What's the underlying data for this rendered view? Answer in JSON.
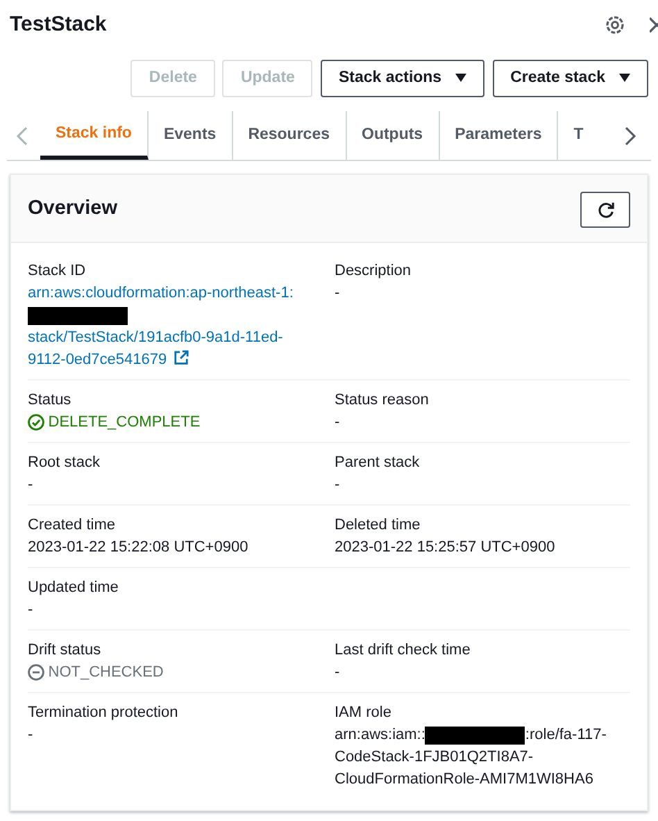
{
  "title": "TestStack",
  "buttons": [
    {
      "label": "Delete",
      "disabled": true,
      "dropdown": false
    },
    {
      "label": "Update",
      "disabled": true,
      "dropdown": false
    },
    {
      "label": "Stack actions",
      "disabled": false,
      "dropdown": true
    },
    {
      "label": "Create stack",
      "disabled": false,
      "dropdown": true
    }
  ],
  "tabs": [
    {
      "label": "Stack info",
      "selected": true
    },
    {
      "label": "Events",
      "selected": false
    },
    {
      "label": "Resources",
      "selected": false
    },
    {
      "label": "Outputs",
      "selected": false
    },
    {
      "label": "Parameters",
      "selected": false
    },
    {
      "label": "T",
      "selected": false
    }
  ],
  "overview": {
    "title": "Overview",
    "rows": [
      {
        "fields": [
          {
            "label": "Stack ID",
            "kind": "link",
            "redacted": true,
            "parts": [
              "arn:aws:cloudformation:ap-northeast-1:",
              "stack/TestStack/191acfb0-9a1d-11ed-9112-0ed7ce541679"
            ]
          },
          {
            "label": "Description",
            "kind": "text",
            "value": "-"
          }
        ]
      },
      {
        "fields": [
          {
            "label": "Status",
            "kind": "status_ok",
            "value": "DELETE_COMPLETE"
          },
          {
            "label": "Status reason",
            "kind": "text",
            "value": "-"
          }
        ]
      },
      {
        "fields": [
          {
            "label": "Root stack",
            "kind": "text",
            "value": "-"
          },
          {
            "label": "Parent stack",
            "kind": "text",
            "value": "-"
          }
        ]
      },
      {
        "fields": [
          {
            "label": "Created time",
            "kind": "text",
            "value": "2023-01-22 15:22:08 UTC+0900"
          },
          {
            "label": "Deleted time",
            "kind": "text",
            "value": "2023-01-22 15:25:57 UTC+0900"
          }
        ]
      },
      {
        "fields": [
          {
            "label": "Updated time",
            "kind": "text",
            "value": "-"
          }
        ]
      },
      {
        "fields": [
          {
            "label": "Drift status",
            "kind": "status_neutral",
            "value": "NOT_CHECKED"
          },
          {
            "label": "Last drift check time",
            "kind": "text",
            "value": "-"
          }
        ]
      },
      {
        "fields": [
          {
            "label": "Termination protection",
            "kind": "text",
            "value": "-"
          },
          {
            "label": "IAM role",
            "kind": "text",
            "redacted": true,
            "parts": [
              "arn:aws:iam::",
              ":role/fa-117-CodeStack-1FJB01Q2TI8A7-CloudFormationRole-AMI7M1WI8HA6"
            ]
          }
        ]
      }
    ]
  }
}
